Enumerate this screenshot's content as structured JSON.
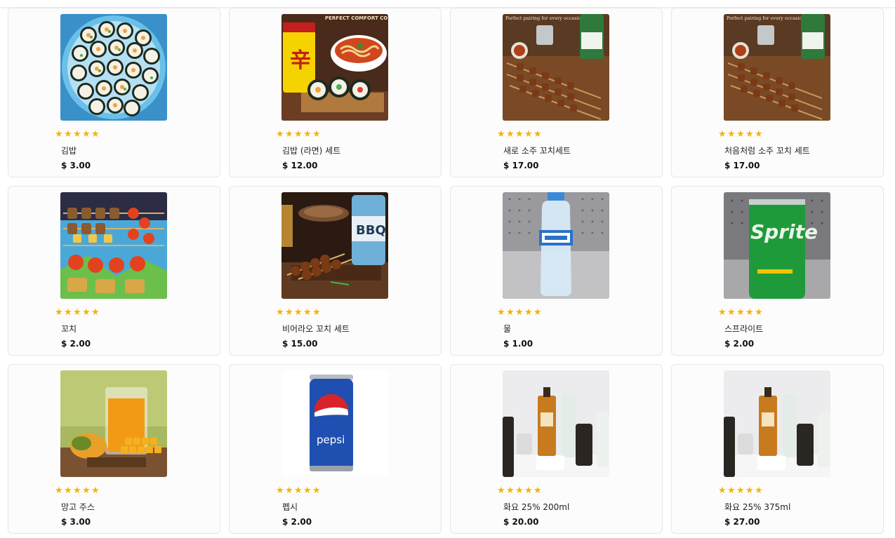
{
  "rating_icon": "star-icon",
  "accent_color": "#f5b400",
  "products": [
    {
      "name": "김밥",
      "price": "$ 3.00",
      "rating": 5,
      "image": "gimbap-photo"
    },
    {
      "name": "김밥 (라면) 세트",
      "price": "$ 12.00",
      "rating": 5,
      "image": "ramen-gimbap-combo-photo",
      "image_text": "PERFECT COMFORT COMBO"
    },
    {
      "name": "새로 소주 꼬치세트",
      "price": "$ 17.00",
      "rating": 5,
      "image": "soju-skewer-set-photo",
      "image_text": "Perfect pairing for every occasion"
    },
    {
      "name": "처음처럼 소주 꼬치 세트",
      "price": "$ 17.00",
      "rating": 5,
      "image": "soju-skewer-set-photo",
      "image_text": "Perfect pairing for every occasion"
    },
    {
      "name": "꼬치",
      "price": "$ 2.00",
      "rating": 5,
      "image": "skewers-photo"
    },
    {
      "name": "비어라오 꼬치 세트",
      "price": "$ 15.00",
      "rating": 5,
      "image": "beerlao-skewer-set-photo",
      "image_text": "BBQ"
    },
    {
      "name": "물",
      "price": "$ 1.00",
      "rating": 5,
      "image": "water-bottle-photo"
    },
    {
      "name": "스프라이트",
      "price": "$ 2.00",
      "rating": 5,
      "image": "sprite-can-photo",
      "image_text": "Sprite"
    },
    {
      "name": "망고 주스",
      "price": "$ 3.00",
      "rating": 5,
      "image": "mango-juice-photo"
    },
    {
      "name": "펩시",
      "price": "$ 2.00",
      "rating": 5,
      "image": "pepsi-can-photo",
      "image_text": "pepsi"
    },
    {
      "name": "화요 25% 200ml",
      "price": "$ 20.00",
      "rating": 5,
      "image": "hwayo-bottles-photo"
    },
    {
      "name": "화요 25% 375ml",
      "price": "$ 27.00",
      "rating": 5,
      "image": "hwayo-bottles-photo"
    }
  ]
}
